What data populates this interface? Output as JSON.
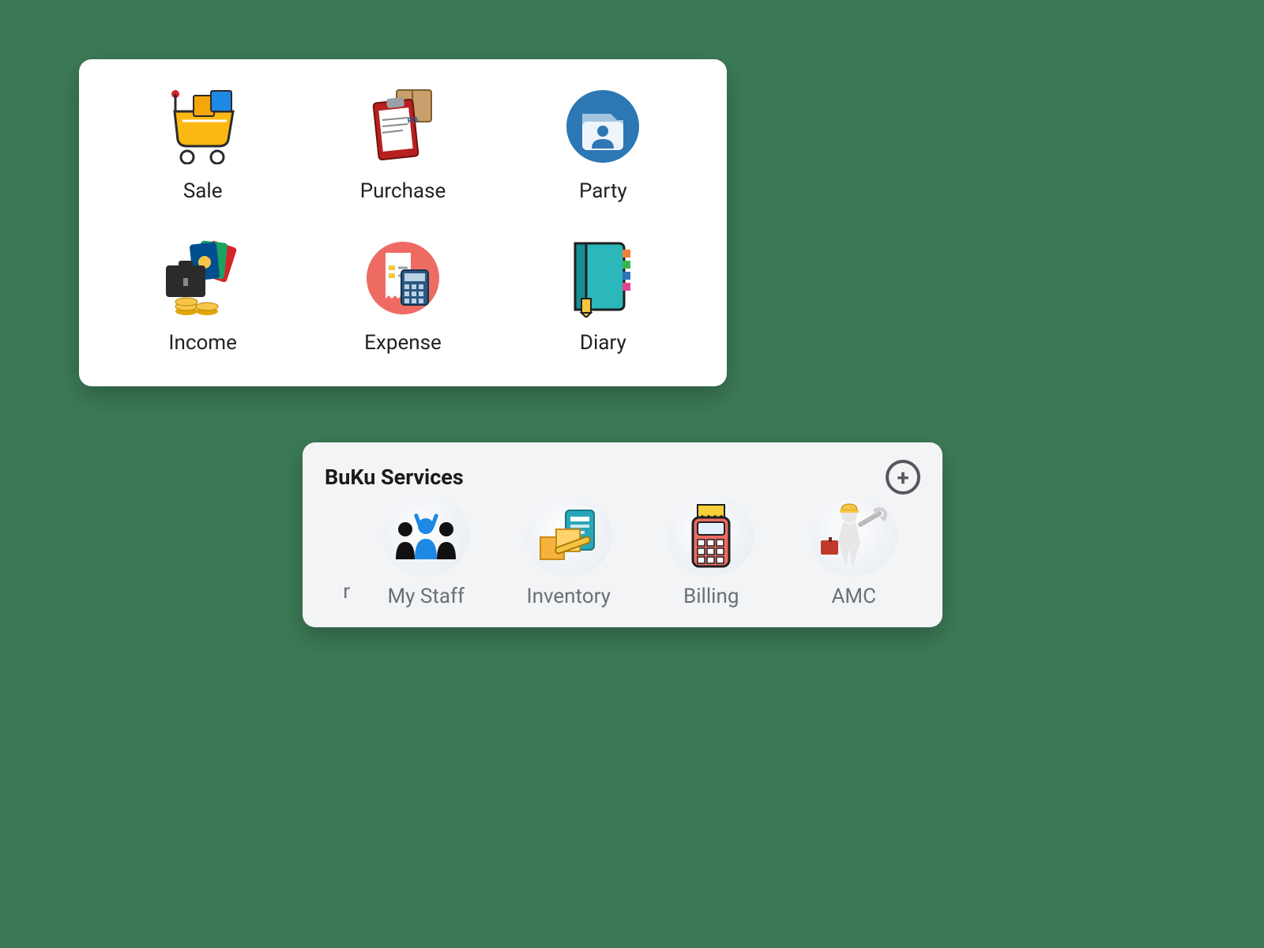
{
  "main_grid": {
    "items": [
      {
        "label": "Sale",
        "icon": "cart-icon"
      },
      {
        "label": "Purchase",
        "icon": "clipboard-box-icon"
      },
      {
        "label": "Party",
        "icon": "contact-folder-icon"
      },
      {
        "label": "Income",
        "icon": "money-briefcase-icon"
      },
      {
        "label": "Expense",
        "icon": "receipt-calc-icon"
      },
      {
        "label": "Diary",
        "icon": "notebook-icon"
      }
    ]
  },
  "services": {
    "title": "BuKu Services",
    "partial_left": "r",
    "items": [
      {
        "label": "My Staff",
        "icon": "team-icon"
      },
      {
        "label": "Inventory",
        "icon": "inventory-icon"
      },
      {
        "label": "Billing",
        "icon": "pos-icon"
      },
      {
        "label": "AMC",
        "icon": "worker-icon"
      }
    ]
  }
}
